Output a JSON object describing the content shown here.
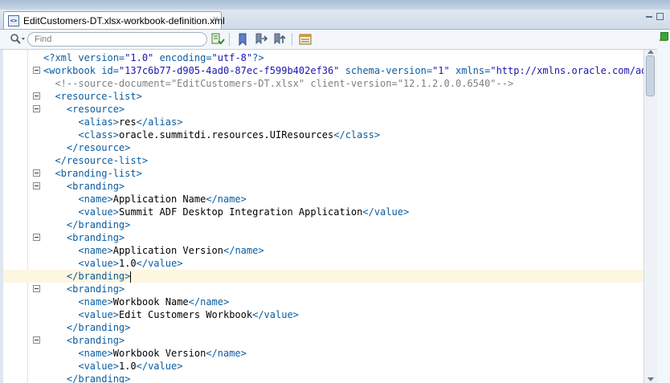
{
  "tab": {
    "title": "EditCustomers-DT.xlsx-workbook-definition.xml",
    "close": "×",
    "icon_text": "<>"
  },
  "toolbar": {
    "find_placeholder": "Find",
    "search_dropdown": "▾"
  },
  "icons": {
    "tab_file": "xml-file-icon",
    "tab_close": "close-icon",
    "search": "search-icon",
    "find_toggle": "find-toggle-icon",
    "bookmark": "bookmark-icon",
    "prev_bookmark": "previous-bookmark-icon",
    "next_bookmark": "next-bookmark-icon",
    "properties": "properties-icon",
    "minimize": "minimize-icon",
    "maximize": "maximize-icon"
  },
  "colors": {
    "tag": "#0a5ca0",
    "value": "#1a14b0",
    "comment": "#808080",
    "current_line": "#fdf6e0"
  },
  "editor": {
    "lines": [
      {
        "fold": false,
        "tokens": [
          {
            "t": "pi",
            "s": "<?xml "
          },
          {
            "t": "attr",
            "s": "version="
          },
          {
            "t": "val",
            "s": "\"1.0\" "
          },
          {
            "t": "attr",
            "s": "encoding="
          },
          {
            "t": "val",
            "s": "\"utf-8\""
          },
          {
            "t": "pi",
            "s": "?>"
          }
        ]
      },
      {
        "fold": true,
        "tokens": [
          {
            "t": "tag",
            "s": "<workbook "
          },
          {
            "t": "attr",
            "s": "id="
          },
          {
            "t": "val",
            "s": "\"137c6b77-d905-4ad0-87ec-f599b402ef36\" "
          },
          {
            "t": "attr",
            "s": "schema-version="
          },
          {
            "t": "val",
            "s": "\"1\" "
          },
          {
            "t": "attr",
            "s": "xmlns="
          },
          {
            "t": "val",
            "s": "\"http://xmlns.oracle.com/adf/d"
          }
        ]
      },
      {
        "fold": false,
        "tokens": [
          {
            "t": "comment",
            "s": "  <!--source-document=\"EditCustomers-DT.xlsx\" client-version=\"12.1.2.0.0.6540\"-->"
          }
        ]
      },
      {
        "fold": true,
        "tokens": [
          {
            "t": "text",
            "s": "  "
          },
          {
            "t": "tag",
            "s": "<resource-list>"
          }
        ]
      },
      {
        "fold": true,
        "tokens": [
          {
            "t": "text",
            "s": "    "
          },
          {
            "t": "tag",
            "s": "<resource>"
          }
        ]
      },
      {
        "fold": false,
        "tokens": [
          {
            "t": "text",
            "s": "      "
          },
          {
            "t": "tag",
            "s": "<alias>"
          },
          {
            "t": "text",
            "s": "res"
          },
          {
            "t": "tag",
            "s": "</alias>"
          }
        ]
      },
      {
        "fold": false,
        "tokens": [
          {
            "t": "text",
            "s": "      "
          },
          {
            "t": "tag",
            "s": "<class>"
          },
          {
            "t": "text",
            "s": "oracle.summitdi.resources.UIResources"
          },
          {
            "t": "tag",
            "s": "</class>"
          }
        ]
      },
      {
        "fold": false,
        "tokens": [
          {
            "t": "text",
            "s": "    "
          },
          {
            "t": "tag",
            "s": "</resource>"
          }
        ]
      },
      {
        "fold": false,
        "tokens": [
          {
            "t": "text",
            "s": "  "
          },
          {
            "t": "tag",
            "s": "</resource-list>"
          }
        ]
      },
      {
        "fold": true,
        "tokens": [
          {
            "t": "text",
            "s": "  "
          },
          {
            "t": "tag",
            "s": "<branding-list>"
          }
        ]
      },
      {
        "fold": true,
        "tokens": [
          {
            "t": "text",
            "s": "    "
          },
          {
            "t": "tag",
            "s": "<branding>"
          }
        ]
      },
      {
        "fold": false,
        "tokens": [
          {
            "t": "text",
            "s": "      "
          },
          {
            "t": "tag",
            "s": "<name>"
          },
          {
            "t": "text",
            "s": "Application Name"
          },
          {
            "t": "tag",
            "s": "</name>"
          }
        ]
      },
      {
        "fold": false,
        "tokens": [
          {
            "t": "text",
            "s": "      "
          },
          {
            "t": "tag",
            "s": "<value>"
          },
          {
            "t": "text",
            "s": "Summit ADF Desktop Integration Application"
          },
          {
            "t": "tag",
            "s": "</value>"
          }
        ]
      },
      {
        "fold": false,
        "tokens": [
          {
            "t": "text",
            "s": "    "
          },
          {
            "t": "tag",
            "s": "</branding>"
          }
        ]
      },
      {
        "fold": true,
        "tokens": [
          {
            "t": "text",
            "s": "    "
          },
          {
            "t": "tag",
            "s": "<branding>"
          }
        ]
      },
      {
        "fold": false,
        "tokens": [
          {
            "t": "text",
            "s": "      "
          },
          {
            "t": "tag",
            "s": "<name>"
          },
          {
            "t": "text",
            "s": "Application Version"
          },
          {
            "t": "tag",
            "s": "</name>"
          }
        ]
      },
      {
        "fold": false,
        "tokens": [
          {
            "t": "text",
            "s": "      "
          },
          {
            "t": "tag",
            "s": "<value>"
          },
          {
            "t": "text",
            "s": "1.0"
          },
          {
            "t": "tag",
            "s": "</value>"
          }
        ]
      },
      {
        "fold": false,
        "current": true,
        "tokens": [
          {
            "t": "text",
            "s": "    "
          },
          {
            "t": "tag",
            "s": "</branding>"
          }
        ]
      },
      {
        "fold": true,
        "tokens": [
          {
            "t": "text",
            "s": "    "
          },
          {
            "t": "tag",
            "s": "<branding>"
          }
        ]
      },
      {
        "fold": false,
        "tokens": [
          {
            "t": "text",
            "s": "      "
          },
          {
            "t": "tag",
            "s": "<name>"
          },
          {
            "t": "text",
            "s": "Workbook Name"
          },
          {
            "t": "tag",
            "s": "</name>"
          }
        ]
      },
      {
        "fold": false,
        "tokens": [
          {
            "t": "text",
            "s": "      "
          },
          {
            "t": "tag",
            "s": "<value>"
          },
          {
            "t": "text",
            "s": "Edit Customers Workbook"
          },
          {
            "t": "tag",
            "s": "</value>"
          }
        ]
      },
      {
        "fold": false,
        "tokens": [
          {
            "t": "text",
            "s": "    "
          },
          {
            "t": "tag",
            "s": "</branding>"
          }
        ]
      },
      {
        "fold": true,
        "tokens": [
          {
            "t": "text",
            "s": "    "
          },
          {
            "t": "tag",
            "s": "<branding>"
          }
        ]
      },
      {
        "fold": false,
        "tokens": [
          {
            "t": "text",
            "s": "      "
          },
          {
            "t": "tag",
            "s": "<name>"
          },
          {
            "t": "text",
            "s": "Workbook Version"
          },
          {
            "t": "tag",
            "s": "</name>"
          }
        ]
      },
      {
        "fold": false,
        "tokens": [
          {
            "t": "text",
            "s": "      "
          },
          {
            "t": "tag",
            "s": "<value>"
          },
          {
            "t": "text",
            "s": "1.0"
          },
          {
            "t": "tag",
            "s": "</value>"
          }
        ]
      },
      {
        "fold": false,
        "tokens": [
          {
            "t": "text",
            "s": "    "
          },
          {
            "t": "tag",
            "s": "</branding>"
          }
        ]
      }
    ]
  }
}
